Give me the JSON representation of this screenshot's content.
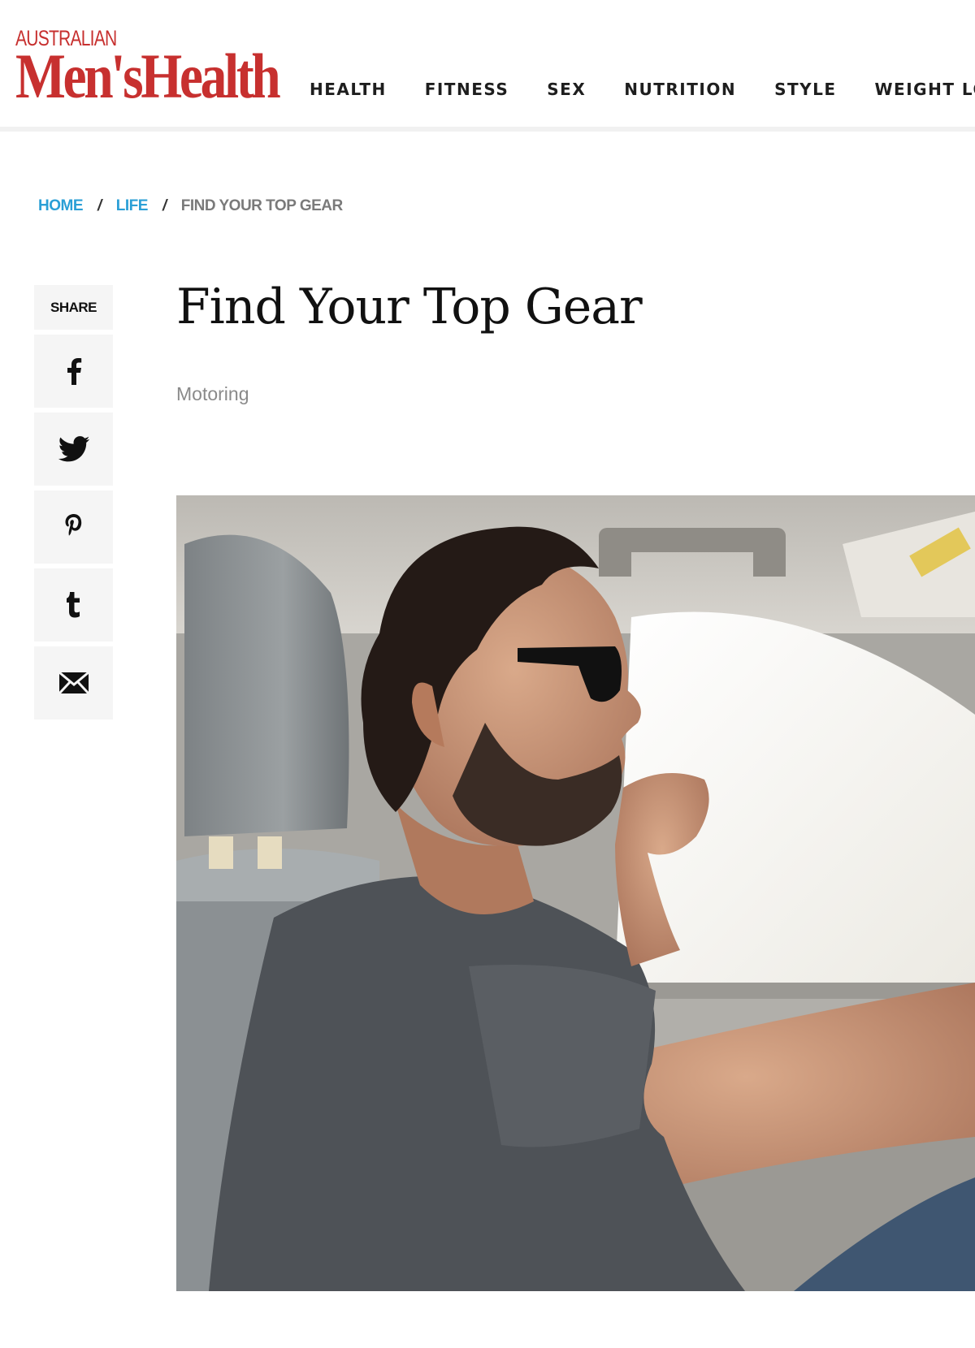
{
  "brand": {
    "small": "AUSTRALIAN",
    "name": "Men'sHealth",
    "color": "#c7302f"
  },
  "nav": {
    "items": [
      {
        "label": "HEALTH"
      },
      {
        "label": "FITNESS"
      },
      {
        "label": "SEX"
      },
      {
        "label": "NUTRITION"
      },
      {
        "label": "STYLE"
      },
      {
        "label": "WEIGHT LOS"
      }
    ]
  },
  "breadcrumb": {
    "home": "HOME",
    "section": "LIFE",
    "current": "FIND YOUR TOP GEAR",
    "separator": "/",
    "link_color": "#2a9fd6"
  },
  "share": {
    "label": "SHARE",
    "buttons": [
      {
        "icon": "facebook-icon"
      },
      {
        "icon": "twitter-icon"
      },
      {
        "icon": "pinterest-icon"
      },
      {
        "icon": "tumblr-icon"
      },
      {
        "icon": "email-icon"
      }
    ]
  },
  "article": {
    "title": "Find Your Top Gear",
    "category": "Motoring",
    "hero_image": "man-driving-car-photo"
  }
}
